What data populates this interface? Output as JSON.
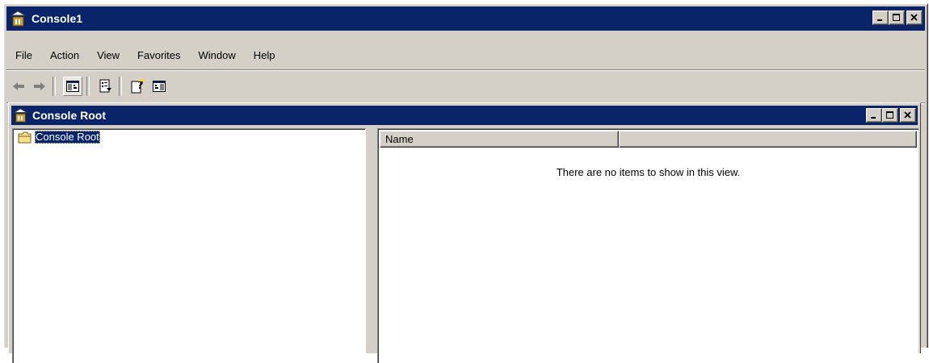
{
  "window": {
    "title": "Console1",
    "icon": "mmc-icon"
  },
  "menu": [
    {
      "label": "File"
    },
    {
      "label": "Action"
    },
    {
      "label": "View"
    },
    {
      "label": "Favorites"
    },
    {
      "label": "Window"
    },
    {
      "label": "Help"
    }
  ],
  "toolbar": {
    "buttons": [
      "back-arrow-icon",
      "forward-arrow-icon",
      "show-hide-tree-icon",
      "export-list-icon",
      "help-icon",
      "show-hide-action-pane-icon"
    ]
  },
  "child_window": {
    "title": "Console Root",
    "icon": "mmc-icon"
  },
  "tree": {
    "items": [
      {
        "label": "Console Root",
        "icon": "folder-icon",
        "selected": true
      }
    ]
  },
  "list": {
    "columns": [
      {
        "label": "Name"
      },
      {
        "label": ""
      }
    ],
    "empty_message": "There are no items to show in this view."
  },
  "colors": {
    "titlebar": "#0a246a",
    "face": "#d4d0c8"
  }
}
